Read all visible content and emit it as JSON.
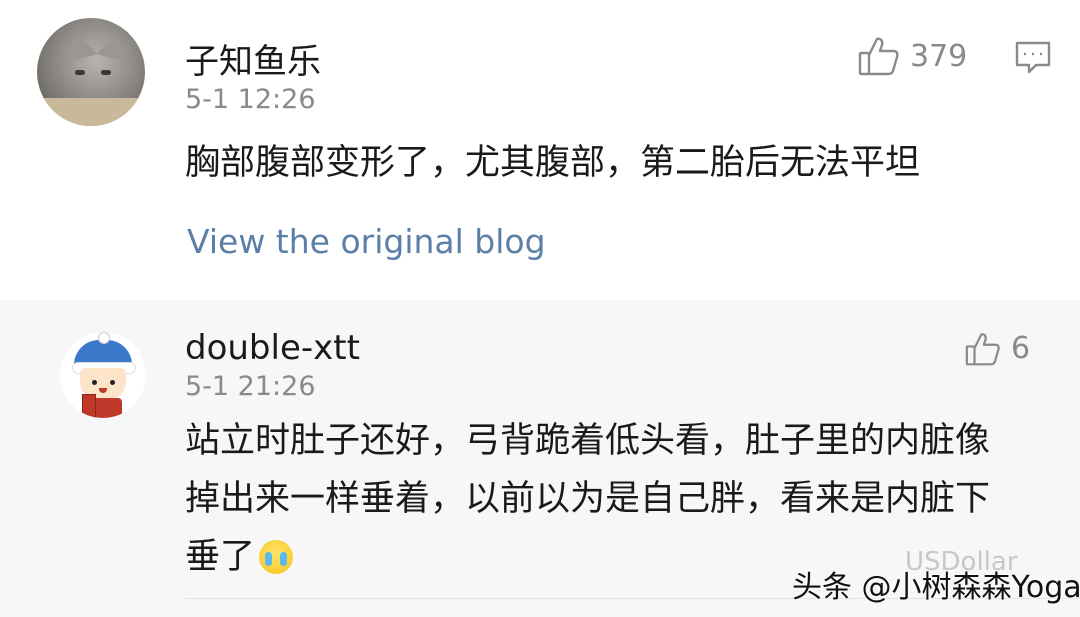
{
  "comments": [
    {
      "username": "子知鱼乐",
      "timestamp": "5-1 12:26",
      "likes": "379",
      "text": "胸部腹部变形了，尤其腹部，第二胎后无法平坦",
      "view_link": "View the original blog",
      "avatar_icon": "cat-photo-avatar"
    },
    {
      "username": "double-xtt",
      "timestamp": "5-1 21:26",
      "likes": "6",
      "text_line1": "站立时肚子还好，弓背跪着低头看，肚子里的内脏像",
      "text_line2": "掉出来一样垂着，以前以为是自己胖，看来是内脏下",
      "text_line3": "垂了",
      "emoji": "crying-face-icon",
      "avatar_icon": "cartoon-kid-avatar"
    }
  ],
  "watermark": {
    "main": "头条 @小树森森Yoga",
    "faint": "USDollar"
  },
  "colors": {
    "link": "#5c7fa8",
    "meta": "#8a8a8a",
    "reply_bg": "#f7f7f7"
  }
}
